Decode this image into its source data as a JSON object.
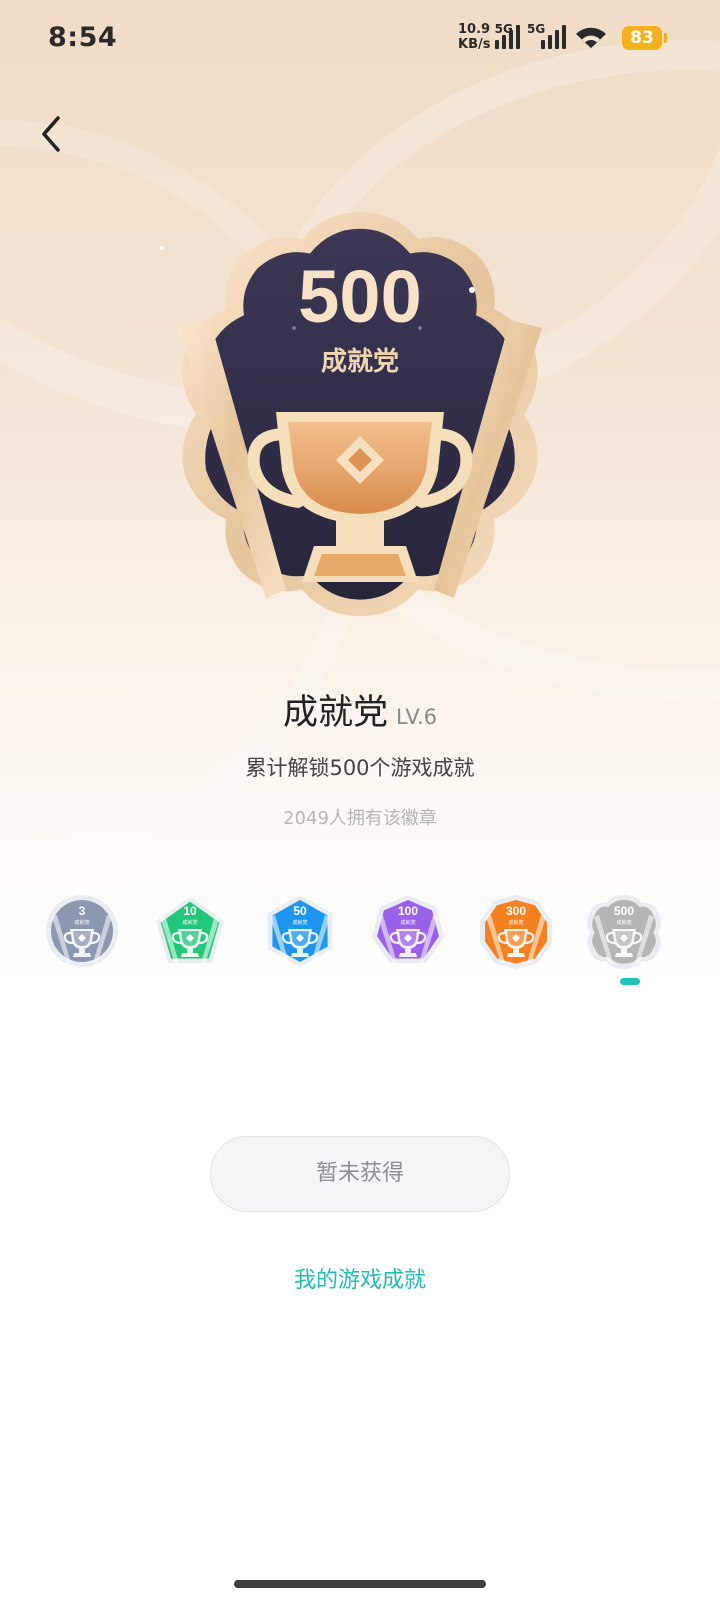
{
  "status_bar": {
    "time": "8:54",
    "net_speed_value": "10.9",
    "net_speed_unit": "KB/s",
    "network_1": "5G",
    "network_2": "5G",
    "battery": "83"
  },
  "badge": {
    "number": "500",
    "name": "成就党",
    "title": "成就党",
    "level": "LV.6",
    "description": "累计解锁500个游戏成就",
    "owners": "2049人拥有该徽章"
  },
  "badge_levels": [
    {
      "value": "3",
      "label": "成就党",
      "color": "#8e97b0"
    },
    {
      "value": "10",
      "label": "成就党",
      "color": "#22c77a"
    },
    {
      "value": "50",
      "label": "成就党",
      "color": "#1e96f0"
    },
    {
      "value": "100",
      "label": "成就党",
      "color": "#9a60ea"
    },
    {
      "value": "300",
      "label": "成就党",
      "color": "#f5801f"
    },
    {
      "value": "500",
      "label": "成就党",
      "color": "#b5b5b5",
      "selected": true
    }
  ],
  "actions": {
    "status_button": "暂未获得",
    "my_achievements_link": "我的游戏成就"
  },
  "colors": {
    "accent": "#1fc0b0",
    "badge_dark": "#2f2c45",
    "badge_gold": "#e8c79c",
    "trophy": "#e8a868"
  }
}
